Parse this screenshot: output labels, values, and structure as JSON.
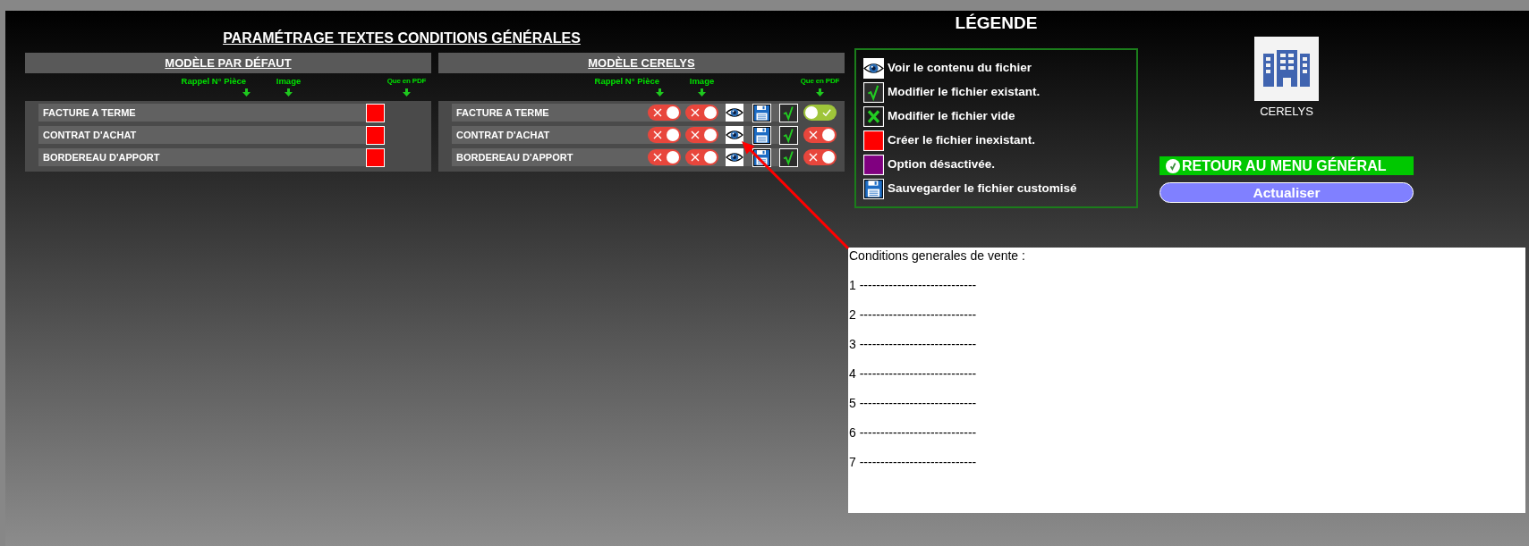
{
  "title": "PARAMÉTRAGE TEXTES CONDITIONS GÉNÉRALES",
  "panels": [
    {
      "kind": "default",
      "title": "MODÈLE PAR DÉFAUT",
      "columns": [
        "Rappel N° Pièce",
        "Image",
        "Que en PDF"
      ],
      "rows": [
        {
          "label": "FACTURE A TERME",
          "kind": "missing"
        },
        {
          "label": "CONTRAT D'ACHAT",
          "kind": "missing"
        },
        {
          "label": "BORDEREAU D'APPORT",
          "kind": "missing"
        }
      ]
    },
    {
      "kind": "custom",
      "title": "MODÈLE CERELYS",
      "columns": [
        "Rappel N° Pièce",
        "Image",
        "Que en PDF"
      ],
      "rows": [
        {
          "label": "FACTURE A TERME",
          "kind": "existing",
          "rappel": {
            "on": false
          },
          "image": {
            "on": false
          },
          "pdf_only": {
            "on": true
          }
        },
        {
          "label": "CONTRAT D'ACHAT",
          "kind": "existing",
          "rappel": {
            "on": false
          },
          "image": {
            "on": false
          },
          "pdf_only": {
            "on": false
          }
        },
        {
          "label": "BORDEREAU D'APPORT",
          "kind": "existing",
          "rappel": {
            "on": false
          },
          "image": {
            "on": false
          },
          "pdf_only": {
            "on": false
          }
        }
      ]
    }
  ],
  "legend": {
    "title": "LÉGENDE",
    "items": [
      {
        "kind": "view",
        "label": "Voir le contenu du fichier"
      },
      {
        "kind": "existing",
        "label": "Modifier le fichier existant."
      },
      {
        "kind": "empty",
        "label": "Modifier le fichier vide"
      },
      {
        "kind": "missing",
        "label": "Créer le fichier inexistant."
      },
      {
        "kind": "disabled",
        "label": "Option désactivée."
      },
      {
        "kind": "save",
        "label": "Sauvegarder le fichier customisé"
      }
    ]
  },
  "company": {
    "name": "CERELYS"
  },
  "back_button": {
    "label": "RETOUR AU MENU GÉNÉRAL"
  },
  "refresh_button": {
    "label": "Actualiser"
  },
  "text_area": {
    "lines": [
      "Conditions generales de vente :",
      "1 ----------------------------",
      "2 ----------------------------",
      "3 ----------------------------",
      "4 ----------------------------",
      "5 ----------------------------",
      "6 ----------------------------",
      "7 ----------------------------"
    ]
  }
}
